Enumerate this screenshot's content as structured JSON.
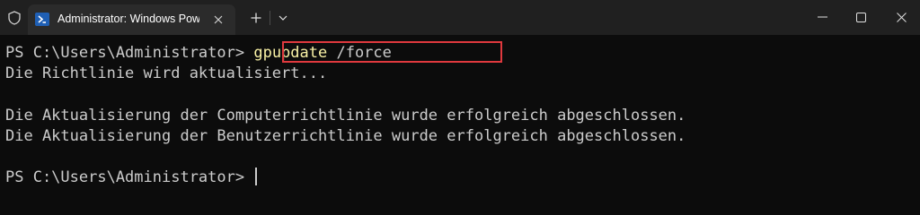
{
  "titlebar": {
    "tab_title": "Administrator: Windows Powe",
    "icons": [
      "shield-icon",
      "powershell-icon",
      "close-icon",
      "plus-icon",
      "chevron-down-icon",
      "minimize-icon",
      "maximize-icon",
      "close-window-icon"
    ]
  },
  "terminal": {
    "prompt1": "PS C:\\Users\\Administrator> ",
    "command": "gpupdate",
    "argument": " /force",
    "output1": "Die Richtlinie wird aktualisiert...",
    "output2": "Die Aktualisierung der Computerrichtlinie wurde erfolgreich abgeschlossen.",
    "output3": "Die Aktualisierung der Benutzerrichtlinie wurde erfolgreich abgeschlossen.",
    "prompt2": "PS C:\\Users\\Administrator> "
  },
  "colors": {
    "background": "#0c0c0c",
    "titlebar": "#202020",
    "tab": "#2b2b2b",
    "text": "#cccccc",
    "command": "#f9f1a5",
    "highlight_border": "#e0393e",
    "powershell_blue": "#1f5fb4"
  }
}
